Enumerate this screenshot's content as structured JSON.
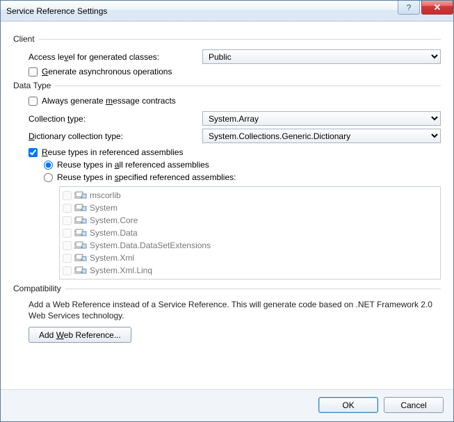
{
  "window": {
    "title": "Service Reference Settings"
  },
  "client": {
    "header": "Client",
    "access_label": "Access level for generated classes:",
    "access_value": "Public",
    "gen_async_label": "Generate asynchronous operations",
    "gen_async_checked": false
  },
  "datatype": {
    "header": "Data Type",
    "always_msg_label": "Always generate message contracts",
    "always_msg_checked": false,
    "collection_label": "Collection type:",
    "collection_value": "System.Array",
    "dictionary_label": "Dictionary collection type:",
    "dictionary_value": "System.Collections.Generic.Dictionary",
    "reuse_label": "Reuse types in referenced assemblies",
    "reuse_checked": true,
    "reuse_all_label": "Reuse types in all referenced assemblies",
    "reuse_specified_label": "Reuse types in specified referenced assemblies:",
    "reuse_mode": "all",
    "assemblies": [
      "mscorlib",
      "System",
      "System.Core",
      "System.Data",
      "System.Data.DataSetExtensions",
      "System.Xml",
      "System.Xml.Linq"
    ]
  },
  "compat": {
    "header": "Compatibility",
    "text": "Add a Web Reference instead of a Service Reference. This will generate code based on .NET Framework 2.0 Web Services technology.",
    "button": "Add Web Reference..."
  },
  "footer": {
    "ok": "OK",
    "cancel": "Cancel"
  }
}
